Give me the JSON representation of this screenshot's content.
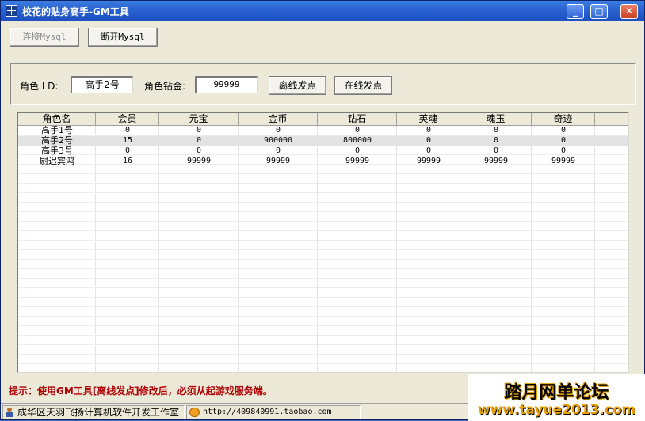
{
  "window": {
    "title": "校花的贴身高手-GM工具",
    "minimize_label": "_",
    "maximize_label": "□",
    "close_label": "✕"
  },
  "toolbar": {
    "connect_label": "连接Mysql",
    "disconnect_label": "断开Mysql"
  },
  "form": {
    "role_id_label": "角色 I D:",
    "role_id_value": "高手2号",
    "diamond_label": "角色钻金:",
    "diamond_value": "99999",
    "offline_send_label": "离线发点",
    "online_send_label": "在线发点"
  },
  "table": {
    "columns": [
      "角色名",
      "会员",
      "元宝",
      "金币",
      "钻石",
      "英魂",
      "魂玉",
      "奇迹"
    ],
    "rows": [
      [
        "高手1号",
        "0",
        "0",
        "0",
        "0",
        "0",
        "0",
        "0"
      ],
      [
        "高手2号",
        "15",
        "0",
        "900000",
        "800000",
        "0",
        "0",
        "0"
      ],
      [
        "高手3号",
        "0",
        "0",
        "0",
        "0",
        "0",
        "0",
        "0"
      ],
      [
        "尉迟宾鸿",
        "16",
        "99999",
        "99999",
        "99999",
        "99999",
        "99999",
        "99999"
      ]
    ],
    "selected_row": 1
  },
  "hint": "提示：使用GM工具[离线发点]修改后，必须从起游戏服务端。",
  "statusbar": {
    "studio": "成华区天羽飞扬计算机软件开发工作室",
    "url": "http://409840991.taobao.com"
  },
  "watermark": {
    "line1": "踏月网单论坛",
    "line2": "www.tayue2013.com"
  }
}
